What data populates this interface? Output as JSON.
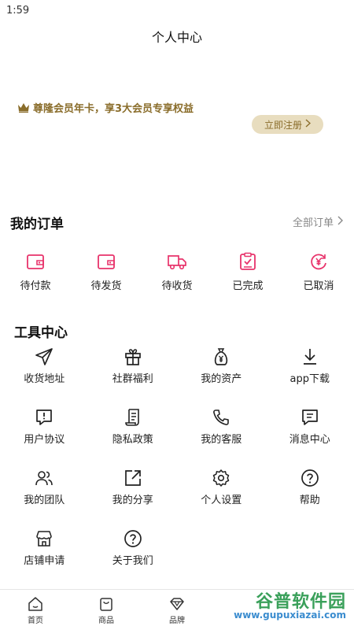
{
  "status_bar": {
    "time": "1:59"
  },
  "header": {
    "title": "个人中心"
  },
  "vip": {
    "banner_text": "尊隆会员年卡，享3大会员专享权益",
    "register_label": "立即注册"
  },
  "orders": {
    "title": "我的订单",
    "all_label": "全部订单",
    "items": [
      {
        "label": "待付款",
        "icon": "wallet-icon"
      },
      {
        "label": "待发货",
        "icon": "wallet-icon"
      },
      {
        "label": "待收货",
        "icon": "truck-icon"
      },
      {
        "label": "已完成",
        "icon": "clipboard-check-icon"
      },
      {
        "label": "已取消",
        "icon": "yen-cancel-icon"
      }
    ]
  },
  "tools": {
    "title": "工具中心",
    "items": [
      {
        "label": "收货地址",
        "icon": "send-icon"
      },
      {
        "label": "社群福利",
        "icon": "gift-icon"
      },
      {
        "label": "我的资产",
        "icon": "money-bag-icon"
      },
      {
        "label": "app下载",
        "icon": "download-icon"
      },
      {
        "label": "用户协议",
        "icon": "agreement-icon"
      },
      {
        "label": "隐私政策",
        "icon": "policy-icon"
      },
      {
        "label": "我的客服",
        "icon": "phone-icon"
      },
      {
        "label": "消息中心",
        "icon": "message-icon"
      },
      {
        "label": "我的团队",
        "icon": "team-icon"
      },
      {
        "label": "我的分享",
        "icon": "share-icon"
      },
      {
        "label": "个人设置",
        "icon": "settings-icon"
      },
      {
        "label": "帮助",
        "icon": "help-icon"
      },
      {
        "label": "店铺申请",
        "icon": "store-icon"
      },
      {
        "label": "关于我们",
        "icon": "about-icon"
      }
    ]
  },
  "bottom_nav": {
    "items": [
      {
        "label": "首页",
        "icon": "home-icon"
      },
      {
        "label": "商品",
        "icon": "bag-icon"
      },
      {
        "label": "品牌",
        "icon": "diamond-icon"
      }
    ]
  },
  "watermark": {
    "title": "谷普软件园",
    "url": "www.gupuxiazai.com"
  },
  "colors": {
    "accent_pink": "#e8336b",
    "gold": "#8a6d2b",
    "gold_bg": "#e8ddbf"
  }
}
